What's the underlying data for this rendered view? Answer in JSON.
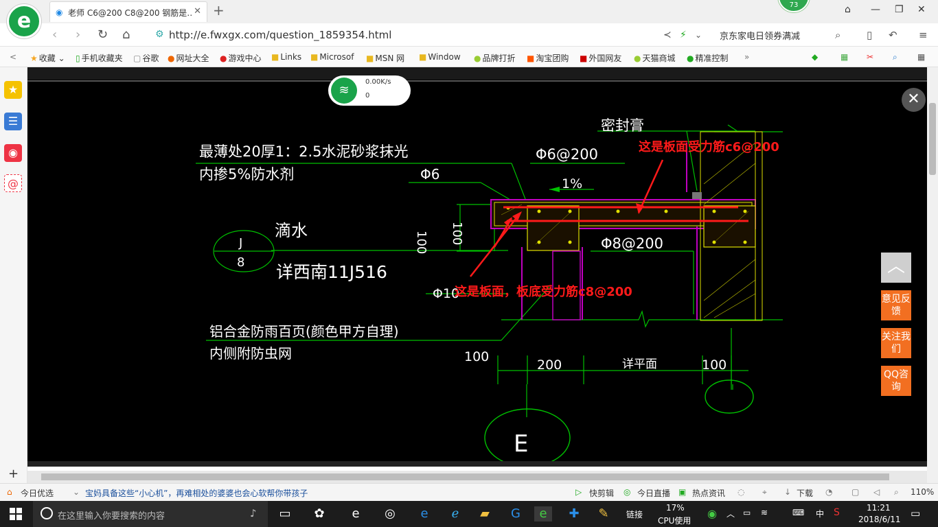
{
  "browser": {
    "tab_title": "老师 C6@200 C8@200 钢筋是…",
    "url": "http://e.fwxgx.com/question_1859354.html",
    "search_hint": "京东家电日领券满减",
    "badge": "73"
  },
  "bookmarks": [
    "收藏",
    "手机收藏夹",
    "谷歌",
    "网址大全",
    "游戏中心",
    "Links",
    "Microsof",
    "MSN 网",
    "Window",
    "品牌打折",
    "淘宝团购",
    "外国网友",
    "天猫商城",
    "精准控制"
  ],
  "net_widget": {
    "speed": "0.00K/s",
    "count": "0"
  },
  "drawing": {
    "text_top1": "最薄处20厚1：2.5水泥砂浆抹光",
    "text_top2": "内掺5%防水剂",
    "seal": "密封膏",
    "rebar_top": "Φ6@200",
    "phi6": "Φ6",
    "slope": "1%",
    "dim100_vert": "100",
    "dim100_vert2": "100",
    "drip": "滴水",
    "detail_top": "J",
    "detail_bottom": "8",
    "detail_ref": "详西南11J516",
    "rebar_bottom": "Φ8@200",
    "phi10": "Φ10",
    "louver1": "铝合金防雨百页(颜色甲方自理)",
    "louver2": "内侧附防虫网",
    "dim_left": "100",
    "dim_200": "200",
    "dim_plan": "详平面",
    "dim_right": "100",
    "axis": "E",
    "annot1": "这是板面受力筋c6@200",
    "annot2": "这是板面，板底受力筋c8@200"
  },
  "side_buttons": {
    "feedback": "意见反馈",
    "follow": "关注我们",
    "qq": "QQ咨询"
  },
  "status": {
    "today": "今日优选",
    "news": "宝妈具备这些“小心机”，再难相处的婆婆也会心软帮你带孩子",
    "clip": "快剪辑",
    "live": "今日直播",
    "hot": "热点资讯",
    "download": "下载",
    "zoom": "110%"
  },
  "taskbar": {
    "search_placeholder": "在这里输入你要搜索的内容",
    "link": "链接",
    "cpu_pct": "17%",
    "cpu_label": "CPU使用",
    "ime": "中",
    "time": "11:21",
    "date": "2018/6/11"
  },
  "colors": {
    "annotation": "#ff1a1a",
    "cad_green": "#00c000",
    "cad_magenta": "#c000c0",
    "cad_yellow": "#e0e000",
    "accent_orange": "#f26f21"
  }
}
